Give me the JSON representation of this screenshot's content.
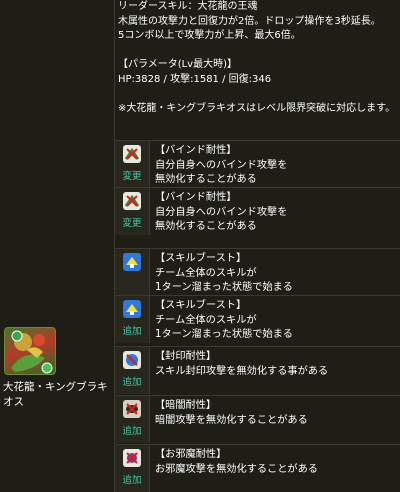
{
  "character": {
    "name": "大花龍・キングブラキオス"
  },
  "leader_block": "リーダースキル：大花龍の王魂\n木属性の攻撃力と回復力が2倍。ドロップ操作を3秒延長。\n5コンボ以上で攻撃力が上昇、最大6倍。\n\n【パラメータ(Lv最大時)】\nHP:3828 / 攻撃:1581 / 回復:346\n\n※大花龍・キングブラキオスはレベル限界突破に対応します。",
  "awakenings": [
    {
      "icon": "bind-resist-icon",
      "status": "変更",
      "text": "【バインド耐性】\n自分自身へのバインド攻撃を\n無効化することがある"
    },
    {
      "icon": "bind-resist-icon",
      "status": "変更",
      "text": "【バインド耐性】\n自分自身へのバインド攻撃を\n無効化することがある"
    },
    {
      "icon": "skill-boost-icon",
      "status": "",
      "text": "【スキルブースト】\nチーム全体のスキルが\n1ターン溜まった状態で始まる"
    },
    {
      "icon": "skill-boost-icon",
      "status": "追加",
      "text": "【スキルブースト】\nチーム全体のスキルが\n1ターン溜まった状態で始まる"
    },
    {
      "icon": "seal-resist-icon",
      "status": "追加",
      "text": "【封印耐性】\nスキル封印攻撃を無効化する事がある"
    },
    {
      "icon": "blind-resist-icon",
      "status": "追加",
      "text": "【暗闇耐性】\n暗闇攻撃を無効化することがある"
    },
    {
      "icon": "jammer-resist-icon",
      "status": "追加",
      "text": "【お邪魔耐性】\nお邪魔攻撃を無効化することがある"
    }
  ]
}
